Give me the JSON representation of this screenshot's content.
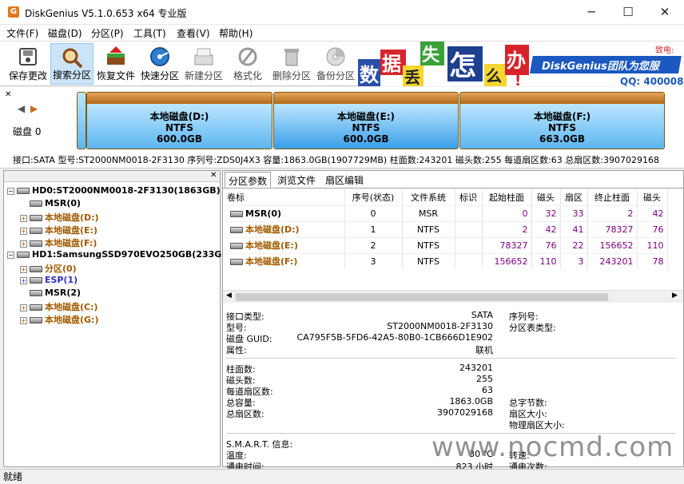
{
  "window": {
    "title": "DiskGenius V5.1.0.653 x64 专业版",
    "icon_letter": "G",
    "minimize": "─",
    "maximize": "☐",
    "close": "✕"
  },
  "menu": [
    "文件(F)",
    "磁盘(D)",
    "分区(P)",
    "工具(T)",
    "查看(V)",
    "帮助(H)"
  ],
  "toolbar": [
    {
      "label": "保存更改",
      "icon": "save-icon",
      "active": false
    },
    {
      "label": "搜索分区",
      "icon": "search-icon",
      "active": true
    },
    {
      "label": "恢复文件",
      "icon": "restore-icon",
      "active": false
    },
    {
      "label": "快速分区",
      "icon": "quick-partition-icon",
      "active": false
    },
    {
      "label": "新建分区",
      "icon": "new-partition-icon",
      "active": false
    },
    {
      "label": "格式化",
      "icon": "format-icon",
      "active": false
    },
    {
      "label": "删除分区",
      "icon": "delete-icon",
      "active": false
    },
    {
      "label": "备份分区",
      "icon": "backup-icon",
      "active": false
    }
  ],
  "banner": {
    "chars": [
      "数",
      "据",
      "丢",
      "失",
      "怎",
      "么",
      "办",
      "!"
    ],
    "slogan": "DiskGenius团队为您服",
    "qq": "QQ: 400008",
    "contact": "致电:"
  },
  "diskmap": {
    "disk_label": "磁盘 0",
    "partitions": [
      {
        "name": "本地磁盘(D:)",
        "fs": "NTFS",
        "size": "600.0GB"
      },
      {
        "name": "本地磁盘(E:)",
        "fs": "NTFS",
        "size": "600.0GB"
      },
      {
        "name": "本地磁盘(F:)",
        "fs": "NTFS",
        "size": "663.0GB"
      }
    ],
    "info": "接口:SATA  型号:ST2000NM0018-2F3130  序列号:ZDS0J4X3  容量:1863.0GB(1907729MB)  柱面数:243201  磁头数:255  每道扇区数:63  总扇区数:3907029168"
  },
  "tree": [
    {
      "level": 0,
      "expander": "−",
      "label": "HD0:ST2000NM0018-2F3130(1863GB)",
      "color": "#000000"
    },
    {
      "level": 1,
      "expander": "",
      "label": "MSR(0)",
      "color": "#000000"
    },
    {
      "level": 1,
      "expander": "+",
      "label": "本地磁盘(D:)",
      "color": "#a05a00"
    },
    {
      "level": 1,
      "expander": "+",
      "label": "本地磁盘(E:)",
      "color": "#a05a00"
    },
    {
      "level": 1,
      "expander": "+",
      "label": "本地磁盘(F:)",
      "color": "#a05a00"
    },
    {
      "level": 0,
      "expander": "−",
      "label": "HD1:SamsungSSD970EVO250GB(233GB)",
      "color": "#000000"
    },
    {
      "level": 1,
      "expander": "+",
      "label": "分区(0)",
      "color": "#a05a00"
    },
    {
      "level": 1,
      "expander": "+",
      "label": "ESP(1)",
      "color": "#3030c0"
    },
    {
      "level": 1,
      "expander": "",
      "label": "MSR(2)",
      "color": "#000000"
    },
    {
      "level": 1,
      "expander": "+",
      "label": "本地磁盘(C:)",
      "color": "#a05a00"
    },
    {
      "level": 1,
      "expander": "+",
      "label": "本地磁盘(G:)",
      "color": "#a05a00"
    }
  ],
  "tabs": [
    "分区参数",
    "浏览文件",
    "扇区编辑"
  ],
  "partition_table": {
    "headers": [
      "卷标",
      "序号(状态)",
      "文件系统",
      "标识",
      "起始柱面",
      "磁头",
      "扇区",
      "终止柱面",
      "磁头"
    ],
    "rows": [
      {
        "label": "MSR(0)",
        "color": "#000000",
        "cells": [
          "0",
          "MSR",
          "",
          "0",
          "32",
          "33",
          "2",
          "42"
        ]
      },
      {
        "label": "本地磁盘(D:)",
        "color": "#a05a00",
        "cells": [
          "1",
          "NTFS",
          "",
          "2",
          "42",
          "41",
          "78327",
          "76"
        ]
      },
      {
        "label": "本地磁盘(E:)",
        "color": "#a05a00",
        "cells": [
          "2",
          "NTFS",
          "",
          "78327",
          "76",
          "22",
          "156652",
          "110"
        ]
      },
      {
        "label": "本地磁盘(F:)",
        "color": "#a05a00",
        "cells": [
          "3",
          "NTFS",
          "",
          "156652",
          "110",
          "3",
          "243201",
          "78"
        ]
      }
    ]
  },
  "details": {
    "left": [
      {
        "label": "接口类型:",
        "value": "SATA"
      },
      {
        "label": "型号:",
        "value": "ST2000NM0018-2F3130"
      },
      {
        "label": "磁盘 GUID:",
        "value": "CA795F5B-5FD6-42A5-80B0-1CB666D1E902"
      },
      {
        "label": "属性:",
        "value": "联机"
      }
    ],
    "right": [
      "序列号:",
      "分区表类型:"
    ],
    "geom": [
      {
        "label": "柱面数:",
        "value": "243201"
      },
      {
        "label": "磁头数:",
        "value": "255"
      },
      {
        "label": "每道扇区数:",
        "value": "63"
      },
      {
        "label": "总容量:",
        "value": "1863.0GB"
      },
      {
        "label": "总扇区数:",
        "value": "3907029168"
      }
    ],
    "geom_right": [
      "总字节数:",
      "扇区大小:",
      "物理扇区大小:"
    ],
    "smart": {
      "title": "S.M.A.R.T. 信息:",
      "temp_label": "温度:",
      "temp": "30 ℃",
      "speed_label": "转速:",
      "power_label": "通电时间:",
      "power": "823 小时",
      "count_label": "通电次数:"
    }
  },
  "status": "就绪",
  "watermark": "www.nocmd.com"
}
